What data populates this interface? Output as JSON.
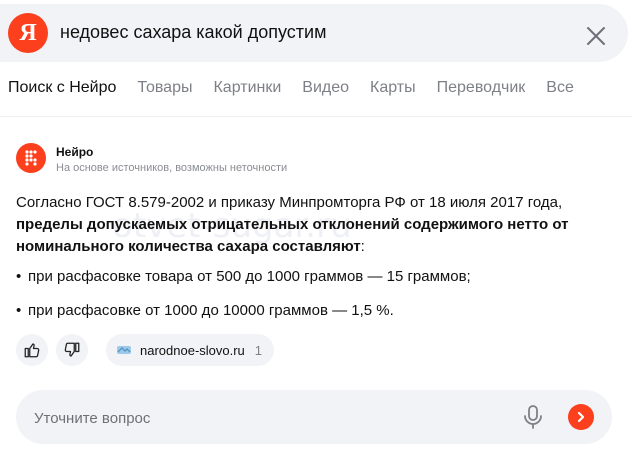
{
  "search": {
    "logo_letter": "Я",
    "query": "недовес сахара какой допустим"
  },
  "tabs": [
    {
      "label": "Поиск с Нейро",
      "active": true
    },
    {
      "label": "Товары"
    },
    {
      "label": "Картинки"
    },
    {
      "label": "Видео"
    },
    {
      "label": "Карты"
    },
    {
      "label": "Переводчик"
    },
    {
      "label": "Все"
    }
  ],
  "answer": {
    "source_name": "Нейро",
    "disclaimer": "На основе источников, возможны неточности",
    "intro": "Согласно ГОСТ 8.579-2002 и приказу Минпромторга РФ от 18 июля 2017 года,",
    "intro_bold": "пределы допускаемых отрицательных отклонений содержимого нетто от номинального количества сахара составляют",
    "intro_end": ":",
    "bullets": [
      "при расфасовке товара от 500 до 1000 граммов — 15 граммов;",
      "при расфасовке от 1000 до 10000 граммов — 1,5 %."
    ],
    "watermark": "otvet-sugar.ru",
    "source_chip": {
      "site": "narodnoe-slovo.ru",
      "count": "1"
    }
  },
  "followup": {
    "placeholder": "Уточните вопрос"
  },
  "colors": {
    "brand": "#fc3f1d",
    "surface": "#f2f3f6",
    "muted_text": "#7e8087"
  }
}
